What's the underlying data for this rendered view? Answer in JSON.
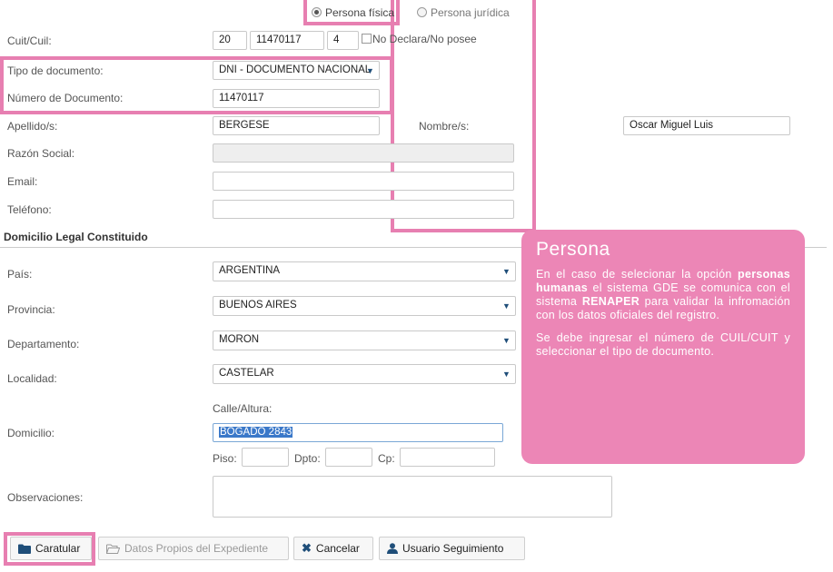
{
  "persona_type": {
    "fisica": "Persona física",
    "juridica": "Persona jurídica",
    "selected": "fisica"
  },
  "fields": {
    "cuit_label": "Cuit/Cuil:",
    "cuit_prefix": "20",
    "cuit_number": "11470117",
    "cuit_suffix": "4",
    "no_declara_label": "No Declara/No posee",
    "tipo_doc_label": "Tipo de documento:",
    "tipo_doc_value": "DNI - DOCUMENTO NACIONAL",
    "numero_doc_label": "Número de Documento:",
    "numero_doc_value": "11470117",
    "apellido_label": "Apellido/s:",
    "apellido_value": "BERGESE",
    "nombre_label": "Nombre/s:",
    "nombre_value": "Oscar Miguel Luis",
    "razon_label": "Razón Social:",
    "razon_value": "",
    "email_label": "Email:",
    "email_value": "",
    "telefono_label": "Teléfono:",
    "telefono_value": ""
  },
  "domicilio": {
    "section_title": "Domicilio Legal Constituido",
    "pais_label": "País:",
    "pais_value": "ARGENTINA",
    "provincia_label": "Provincia:",
    "provincia_value": "BUENOS AIRES",
    "departamento_label": "Departamento:",
    "departamento_value": "MORON",
    "localidad_label": "Localidad:",
    "localidad_value": "CASTELAR",
    "calle_label": "Calle/Altura:",
    "domicilio_label": "Domicilio:",
    "domicilio_value": "BOGADO 2843",
    "piso_label": "Piso:",
    "dpto_label": "Dpto:",
    "cp_label": "Cp:",
    "observaciones_label": "Observaciones:"
  },
  "buttons": {
    "caratular": "Caratular",
    "datos_propios": "Datos Propios del Expediente",
    "cancelar": "Cancelar",
    "usuario_seguimiento": "Usuario Seguimiento"
  },
  "callout": {
    "title": "Persona",
    "p1_a": "En el caso de selecionar la opción ",
    "p1_b": "personas humanas",
    "p1_c": " el sistema GDE se comunica con el sistema ",
    "p1_d": "RENAPER",
    "p1_e": " para validar la infromación con los datos oficiales del registro.",
    "p2": "Se debe ingresar el número de CUIL/CUIT y seleccionar el tipo de documento."
  },
  "colors": {
    "highlight": "#e77fb1",
    "callout_bg": "#ec86b6",
    "icon_blue": "#1f4e79"
  }
}
